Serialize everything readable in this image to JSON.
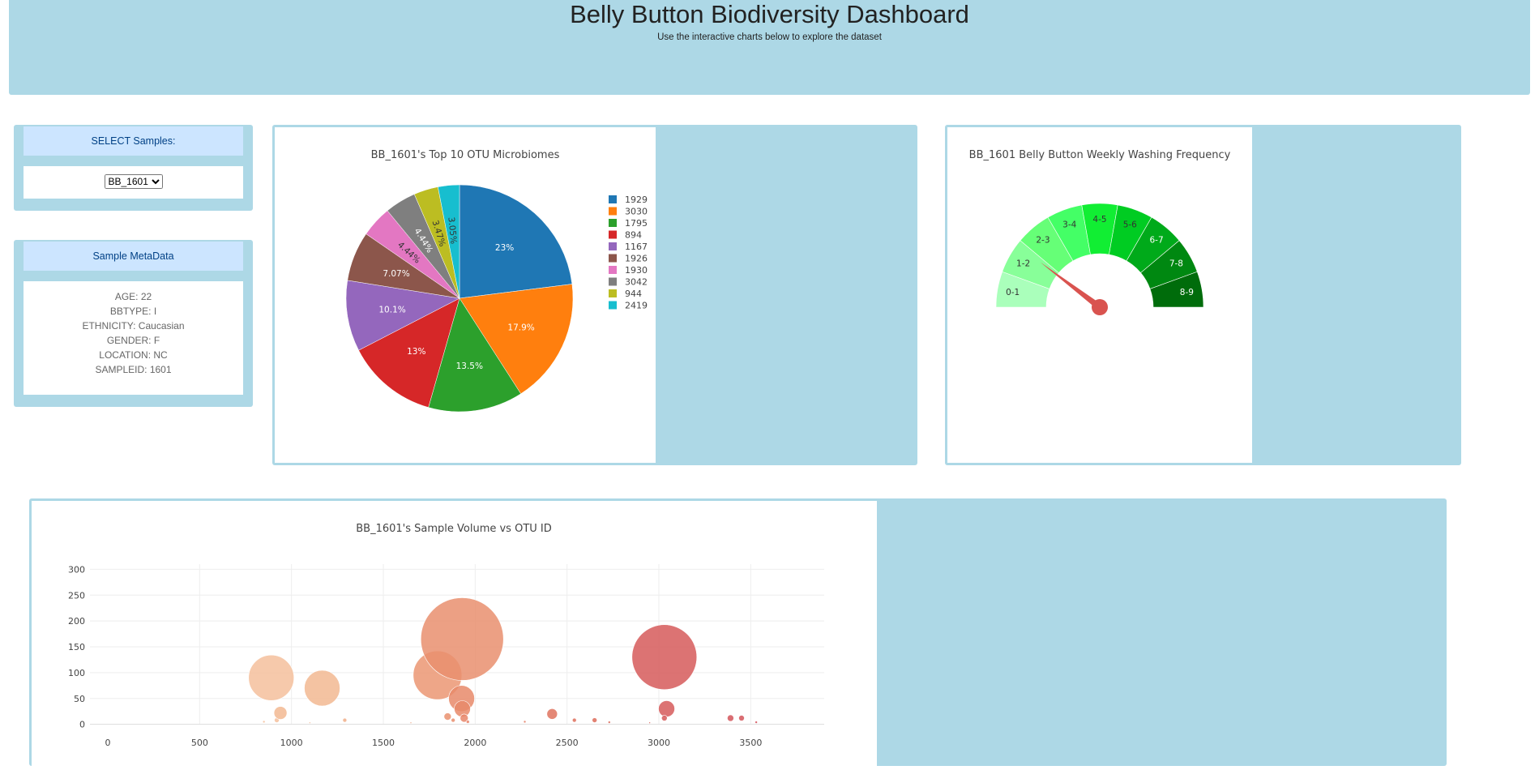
{
  "header": {
    "title": "Belly Button Biodiversity Dashboard",
    "subtitle": "Use the interactive charts below to explore the dataset"
  },
  "selector": {
    "heading": "SELECT Samples:",
    "selected": "BB_1601"
  },
  "metadata": {
    "heading": "Sample MetaData",
    "lines": [
      "AGE: 22",
      "BBTYPE: I",
      "ETHNICITY: Caucasian",
      "GENDER: F",
      "LOCATION: NC",
      "SAMPLEID: 1601"
    ]
  },
  "colors": {
    "panel_bg": "#add8e6",
    "panel_heading_bg": "#cce5ff",
    "panel_heading_text": "#004085",
    "needle": "#d9534f"
  },
  "chart_data": [
    {
      "type": "pie",
      "title": "BB_1601's Top 10 OTU Microbiomes",
      "labels": [
        "1929",
        "3030",
        "1795",
        "894",
        "1167",
        "1926",
        "1930",
        "3042",
        "944",
        "2419"
      ],
      "values": [
        23,
        17.9,
        13.5,
        13,
        10.1,
        7.07,
        4.44,
        4.44,
        3.47,
        3.05
      ],
      "text_labels": [
        "23%",
        "17.9%",
        "13.5%",
        "13%",
        "10.1%",
        "7.07%",
        "4.44%",
        "4.44%",
        "3.47%",
        "3.05%"
      ],
      "colors": [
        "#1f77b4",
        "#ff7f0e",
        "#2ca02c",
        "#d62728",
        "#9467bd",
        "#8c564b",
        "#e377c2",
        "#7f7f7f",
        "#bcbd22",
        "#17becf"
      ],
      "legend": "right"
    },
    {
      "type": "gauge",
      "title": "BB_1601 Belly Button Weekly Washing Frequency",
      "segments": [
        "0-1",
        "1-2",
        "2-3",
        "3-4",
        "4-5",
        "5-6",
        "6-7",
        "7-8",
        "8-9"
      ],
      "segment_colors": [
        "#aaffbb",
        "#88ff99",
        "#66ff77",
        "#44ff66",
        "#11ee33",
        "#00cc22",
        "#00aa1a",
        "#008811",
        "#006c0b"
      ],
      "value": 2,
      "range": [
        0,
        9
      ]
    },
    {
      "type": "scatter",
      "title": "BB_1601's Sample Volume vs OTU ID",
      "xlabel": "",
      "ylabel": "",
      "xlim": [
        -150,
        3900
      ],
      "ylim": [
        -10,
        310
      ],
      "xticks": [
        0,
        500,
        1000,
        1500,
        2000,
        2500,
        3000,
        3500
      ],
      "yticks": [
        0,
        50,
        100,
        150,
        200,
        250,
        300
      ],
      "grid": true,
      "points": [
        {
          "x": 850,
          "y": 5,
          "r": 1.5,
          "c": "#f4c09c"
        },
        {
          "x": 890,
          "y": 90,
          "r": 28,
          "c": "#f4c09c"
        },
        {
          "x": 920,
          "y": 8,
          "r": 3,
          "c": "#f4c09c"
        },
        {
          "x": 940,
          "y": 22,
          "r": 8,
          "c": "#f2b892"
        },
        {
          "x": 1100,
          "y": 3,
          "r": 1,
          "c": "#f2b892"
        },
        {
          "x": 1167,
          "y": 70,
          "r": 22,
          "c": "#f2b892"
        },
        {
          "x": 1290,
          "y": 8,
          "r": 2.5,
          "c": "#f0ae88"
        },
        {
          "x": 1650,
          "y": 3,
          "r": 1,
          "c": "#ed9f7a"
        },
        {
          "x": 1795,
          "y": 95,
          "r": 30,
          "c": "#eb9673"
        },
        {
          "x": 1850,
          "y": 15,
          "r": 4.5,
          "c": "#ea9270"
        },
        {
          "x": 1880,
          "y": 8,
          "r": 2.5,
          "c": "#e98e6d"
        },
        {
          "x": 1926,
          "y": 50,
          "r": 16,
          "c": "#e8896a"
        },
        {
          "x": 1929,
          "y": 165,
          "r": 51,
          "c": "#e98f6e"
        },
        {
          "x": 1930,
          "y": 30,
          "r": 10,
          "c": "#e8896a"
        },
        {
          "x": 1940,
          "y": 12,
          "r": 5,
          "c": "#e7866a"
        },
        {
          "x": 1960,
          "y": 5,
          "r": 2,
          "c": "#e7856a"
        },
        {
          "x": 2270,
          "y": 5,
          "r": 1.5,
          "c": "#e27a62"
        },
        {
          "x": 2419,
          "y": 20,
          "r": 6.5,
          "c": "#df735e"
        },
        {
          "x": 2540,
          "y": 8,
          "r": 2.5,
          "c": "#de6f5c"
        },
        {
          "x": 2650,
          "y": 8,
          "r": 3,
          "c": "#dd6c5b"
        },
        {
          "x": 2730,
          "y": 4,
          "r": 1.5,
          "c": "#dc6a5a"
        },
        {
          "x": 2950,
          "y": 3,
          "r": 1,
          "c": "#d9625a"
        },
        {
          "x": 3030,
          "y": 130,
          "r": 40,
          "c": "#d65a5b"
        },
        {
          "x": 3042,
          "y": 30,
          "r": 10,
          "c": "#d65a5b"
        },
        {
          "x": 3030,
          "y": 12,
          "r": 3.5,
          "c": "#d65a5b"
        },
        {
          "x": 3390,
          "y": 12,
          "r": 4,
          "c": "#d4555a"
        },
        {
          "x": 3450,
          "y": 12,
          "r": 3.5,
          "c": "#d4555a"
        },
        {
          "x": 3530,
          "y": 4,
          "r": 1.5,
          "c": "#d3525a"
        }
      ]
    }
  ]
}
